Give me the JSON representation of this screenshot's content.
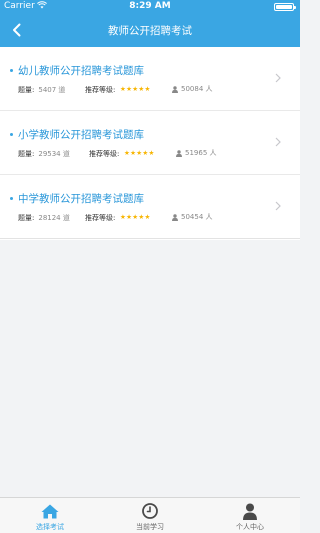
{
  "status_bar": {
    "carrier": "Carrier",
    "time": "8:29 AM",
    "battery_level": 1.0
  },
  "nav": {
    "title": "教师公开招聘考试",
    "back_icon": "chevron-left-icon"
  },
  "colors": {
    "accent": "#3aa6e3",
    "title_text": "#2a97d9",
    "star": "#f7b500"
  },
  "list": {
    "items": [
      {
        "name": "幼儿教师公开招聘考试题库",
        "count_label": "题量:",
        "count_value": "5407 道",
        "rec_label": "推荐等级:",
        "stars": "★★★★★",
        "rating": 5,
        "people": "50084 人"
      },
      {
        "name": "小学教师公开招聘考试题库",
        "count_label": "题量:",
        "count_value": "29534 道",
        "rec_label": "推荐等级:",
        "stars": "★★★★★",
        "rating": 5,
        "people": "51965 人"
      },
      {
        "name": "中学教师公开招聘考试题库",
        "count_label": "题量:",
        "count_value": "28124 道",
        "rec_label": "推荐等级:",
        "stars": "★★★★★",
        "rating": 5,
        "people": "50454 人"
      }
    ]
  },
  "tabs": [
    {
      "label": "选择考试",
      "icon": "home-icon",
      "active": true
    },
    {
      "label": "当前学习",
      "icon": "clock-icon",
      "active": false
    },
    {
      "label": "个人中心",
      "icon": "person-icon",
      "active": false
    }
  ]
}
